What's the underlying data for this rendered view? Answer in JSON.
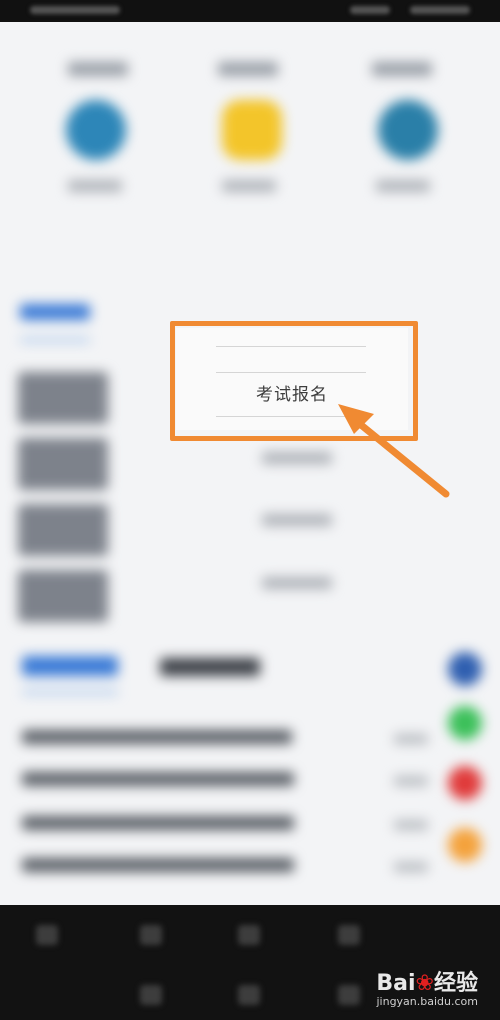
{
  "popup": {
    "item_label": "考试报名"
  },
  "watermark": {
    "brand_prefix": "Bai",
    "brand_suffix": "经验",
    "url": "jingyan.baidu.com"
  },
  "colors": {
    "highlight": "#f08a32",
    "bottom_bar": "#121212"
  }
}
